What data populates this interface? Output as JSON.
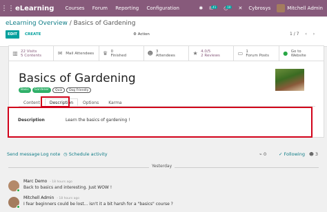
{
  "topbar": {
    "app_name": "eLearning",
    "menu": [
      "Courses",
      "Forum",
      "Reporting",
      "Configuration"
    ],
    "messages_count": "41",
    "activities_count": "10",
    "company": "Cybrosys",
    "user": "Mitchell Admin"
  },
  "control": {
    "breadcrumb_parent": "eLearning Overview",
    "breadcrumb_sep": "/",
    "breadcrumb_current": "Basics of Gardening",
    "edit_label": "EDIT",
    "create_label": "CREATE",
    "action_label": "Action",
    "pager": "1 / 7"
  },
  "stats": [
    {
      "icon": "bar-chart-icon",
      "line1": "22 Visits",
      "line2": "5 Contents"
    },
    {
      "icon": "envelope-icon",
      "line1": "Mail Attendees",
      "line2": ""
    },
    {
      "icon": "trophy-icon",
      "line1": "0",
      "line2": "Finished"
    },
    {
      "icon": "users-icon",
      "line1": "3",
      "line2": "Attendees"
    },
    {
      "icon": "star-icon",
      "line1": "4.0/5",
      "line2": "2 Reviews"
    },
    {
      "icon": "comment-icon",
      "line1": "1",
      "line2": "Forum Posts"
    },
    {
      "icon": "globe-icon",
      "line1": "Go to",
      "line2": "Website"
    }
  ],
  "course": {
    "title": "Basics of Gardening",
    "tags": [
      "Basic",
      "Gardener",
      "Quiz",
      "Dog Friendly"
    ]
  },
  "tabs": [
    "Content",
    "Description",
    "Options",
    "Karma"
  ],
  "description": {
    "label": "Description",
    "value": "Learn the basics of gardening !"
  },
  "chatter": {
    "send_message": "Send message",
    "log_note": "Log note",
    "schedule_activity": "Schedule activity",
    "attachments": "0",
    "following": "Following",
    "followers": "3",
    "date_separator": "Yesterday",
    "messages": [
      {
        "author": "Marc Demo",
        "time": "- 18 hours ago",
        "body": "Back to basics and interesting. Just WOW !"
      },
      {
        "author": "Mitchell Admin",
        "time": "- 18 hours ago",
        "body": "I fear beginners could be lost... isn't it a bit harsh for a \"basics\" course ?"
      }
    ]
  }
}
